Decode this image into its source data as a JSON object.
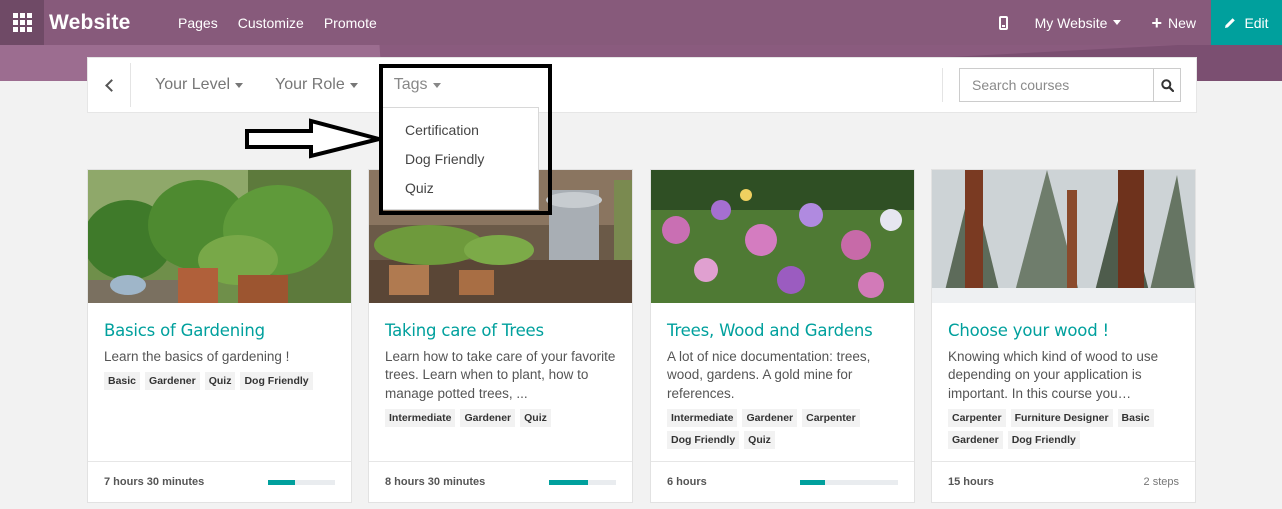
{
  "topbar": {
    "brand": "Website",
    "menu": [
      "Pages",
      "Customize",
      "Promote"
    ],
    "site_selector": "My Website",
    "new_label": "New",
    "edit_label": "Edit",
    "accent_color": "#875a7b",
    "edit_color": "#00a09d"
  },
  "filters": {
    "level": "Your Level",
    "role": "Your Role",
    "tags": "Tags",
    "search_placeholder": "Search courses"
  },
  "tags_dropdown": {
    "options": [
      "Certification",
      "Dog Friendly",
      "Quiz"
    ]
  },
  "courses": [
    {
      "title": "Basics of Gardening",
      "description": "Learn the basics of gardening !",
      "tags": [
        "Basic",
        "Gardener",
        "Quiz",
        "Dog Friendly"
      ],
      "duration": "7 hours 30 minutes",
      "progress": 0.4
    },
    {
      "title": "Taking care of Trees",
      "description": "Learn how to take care of your favorite trees. Learn when to plant, how to manage potted trees, ...",
      "tags": [
        "Intermediate",
        "Gardener",
        "Quiz"
      ],
      "duration": "8 hours 30 minutes",
      "progress": 0.58
    },
    {
      "title": "Trees, Wood and Gardens",
      "description": "A lot of nice documentation: trees, wood, gardens. A gold mine for references.",
      "tags": [
        "Intermediate",
        "Gardener",
        "Carpenter",
        "Dog Friendly",
        "Quiz"
      ],
      "duration": "6 hours",
      "progress": 0.25
    },
    {
      "title": "Choose your wood !",
      "description": "Knowing which kind of wood to use depending on your application is important. In this course you…",
      "tags": [
        "Carpenter",
        "Furniture Designer",
        "Basic",
        "Gardener",
        "Dog Friendly"
      ],
      "duration": "15 hours",
      "steps": "2 steps"
    }
  ]
}
